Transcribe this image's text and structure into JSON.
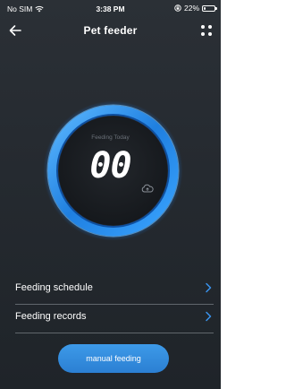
{
  "status_bar": {
    "carrier": "No SIM",
    "time": "3:38 PM",
    "battery": "22%",
    "battery_level": 0.22,
    "icons": [
      "wifi-icon",
      "orientation-lock-icon",
      "battery-icon"
    ]
  },
  "nav": {
    "title": "Pet  feeder",
    "back_icon": "arrow-left-icon",
    "more_icon": "grid-dots-icon"
  },
  "dial": {
    "label": "Feeding Today",
    "count": "00",
    "cloud_icon": "cloud-icon",
    "accent_color": "#2f8fe6"
  },
  "menu": {
    "items": [
      {
        "label": "Feeding schedule",
        "icon": "chevron-right-icon"
      },
      {
        "label": "Feeding records",
        "icon": "chevron-right-icon"
      }
    ]
  },
  "actions": {
    "manual_feeding_label": "manual feeding"
  },
  "colors": {
    "background": "#262b31",
    "accent": "#2f8fe6",
    "text": "#ffffff"
  }
}
